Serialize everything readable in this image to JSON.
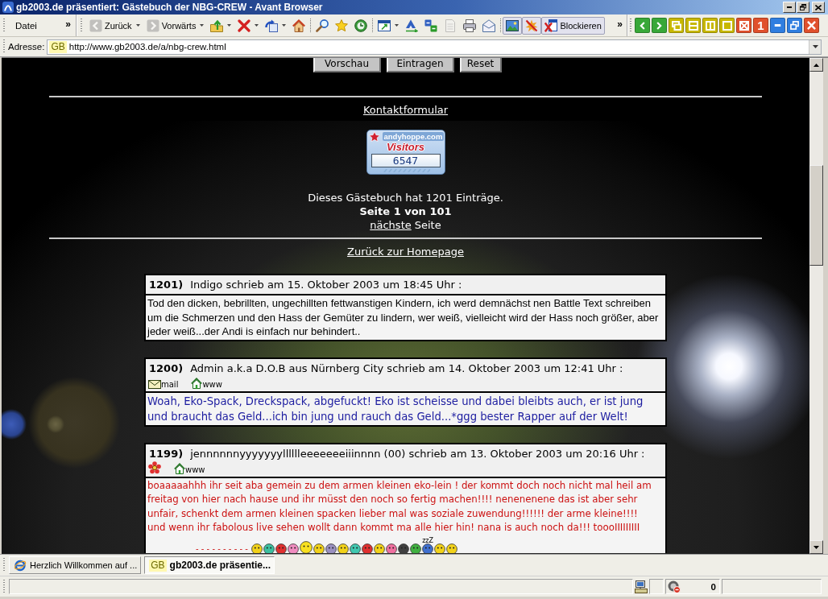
{
  "window": {
    "title": "gb2003.de präsentiert: Gästebuch der NBG-CREW - Avant Browser"
  },
  "menu_bar": {
    "items": [
      {
        "label": "Datei"
      }
    ],
    "overflow": "»"
  },
  "toolbar": {
    "groups": [
      {
        "buttons": [
          {
            "label": "Zurück",
            "disabled": true,
            "dropdown": true,
            "pressed": false
          },
          {
            "label": "Vorwärts",
            "disabled": true,
            "dropdown": true,
            "pressed": false
          },
          {
            "disabled": false,
            "dropdown": true,
            "pressed": false
          },
          {
            "disabled": false,
            "dropdown": true,
            "pressed": false
          },
          {
            "disabled": false,
            "dropdown": true,
            "pressed": false
          },
          {
            "disabled": false,
            "dropdown": false,
            "pressed": false
          }
        ]
      },
      {
        "buttons": [
          {
            "disabled": false,
            "dropdown": false,
            "pressed": false
          },
          {
            "disabled": false,
            "dropdown": false,
            "pressed": false
          },
          {
            "disabled": false,
            "dropdown": false,
            "pressed": false
          }
        ]
      },
      {
        "buttons": [
          {
            "disabled": false,
            "dropdown": true,
            "pressed": false
          },
          {
            "disabled": false,
            "dropdown": false,
            "pressed": false
          },
          {
            "disabled": false,
            "dropdown": false,
            "pressed": false
          },
          {
            "disabled": true,
            "dropdown": false,
            "pressed": false
          },
          {
            "disabled": false,
            "dropdown": false,
            "pressed": false
          },
          {
            "disabled": false,
            "dropdown": false,
            "pressed": false
          }
        ]
      },
      {
        "buttons": [
          {
            "disabled": false,
            "dropdown": false,
            "pressed": true
          },
          {
            "disabled": false,
            "dropdown": false,
            "pressed": true
          },
          {
            "label": "Blockieren",
            "disabled": false,
            "dropdown": false,
            "pressed": true
          }
        ]
      }
    ],
    "overflow": "»"
  },
  "window_buttons": [
    {
      "color": "#38a838"
    },
    {
      "color": "#38a838"
    },
    {
      "color": "#c8b800"
    },
    {
      "color": "#c8b800"
    },
    {
      "color": "#c8b800"
    },
    {
      "color": "#c8b800"
    },
    {
      "color": "#e0502c"
    },
    {
      "color": "#e0502c",
      "label": "1"
    },
    {
      "color": "#2f7ee0"
    },
    {
      "color": "#2f7ee0"
    },
    {
      "color": "#e0502c"
    }
  ],
  "address_bar": {
    "label": "Adresse:",
    "favicon": "GB",
    "value": "http://www.gb2003.de/a/nbg-crew.html"
  },
  "page": {
    "form_buttons": [
      {
        "label": "Vorschau"
      },
      {
        "label": "Eintragen"
      },
      {
        "label": "Reset"
      }
    ],
    "contact_link": "Kontaktformular",
    "counter": {
      "site": "andyhoppe.com",
      "label": "Visitors",
      "count": "6547"
    },
    "summary": "Dieses Gästebuch hat 1201 Einträge.",
    "page_info": "Seite 1 von 101",
    "next_link": "nächste",
    "next_label": "Seite",
    "home_link": "Zurück zur Homepage",
    "entries": [
      {
        "number": "1201)",
        "header": "Indigo schrieb am 15. Oktober 2003 um 18:45 Uhr :",
        "kind": "plain",
        "color": "#000000",
        "body": "Tod den dicken, bebrillten, ungechillten fettwanstigen Kindern, ich werd demnächst nen Battle Text schreiben um die Schmerzen und den Hass der Gemüter zu lindern, wer weiß, vielleicht wird der Hass noch größer, aber jeder weiß...der Andi is einfach nur behindert.."
      },
      {
        "number": "1200)",
        "header": "Admin a.k.a D.O.B aus Nürnberg City schrieb am 14. Oktober 2003 um 12:41 Uhr :",
        "links": [
          {
            "kind": "mail",
            "label": "mail"
          },
          {
            "kind": "home",
            "label": "www"
          }
        ],
        "kind": "styled",
        "color": "#1c1ca0",
        "body": "Woah, Eko-Spack, Dreckspack, abgefuckt! Eko ist scheisse und dabei bleibts auch, er ist jung und braucht das Geld...ich bin jung und rauch das Geld...*ggg bester Rapper auf der Welt!"
      },
      {
        "number": "1199)",
        "header": "jennnnnnyyyyyyylllllleeeeeeeiiinnnn (00) schrieb am 13. Oktober 2003 um 20:16 Uhr :",
        "links": [
          {
            "kind": "flower"
          },
          {
            "kind": "home",
            "label": "www"
          }
        ],
        "kind": "handwritten",
        "color": "#cc1111",
        "body": "boaaaaahhh ihr seit aba gemein zu dem armen kleinen eko-lein ! der kommt doch noch nicht mal heil am freitag von hier nach hause und ihr müsst den noch so fertig machen!!!! nenenenene das ist aber sehr unfair, schenkt dem armen kleinen spacken lieber mal was soziale zuwendung!!!!!! der arme kleine!!!!\nund wenn ihr fabolous live sehen wollt dann kommt ma alle hier hin! nana is auch noch da!!! toooIIIIIIIII",
        "emoticons": {
          "line": "----------",
          "caption": "zzZ"
        }
      }
    ]
  },
  "tabs": [
    {
      "kind": "browser",
      "label": "Herzlich Willkommen auf ...",
      "selected": false
    },
    {
      "kind": "site",
      "favicon": "GB",
      "label": "gb2003.de präsentie...",
      "selected": true
    }
  ],
  "status_bar": {
    "blocked_count": "0"
  }
}
